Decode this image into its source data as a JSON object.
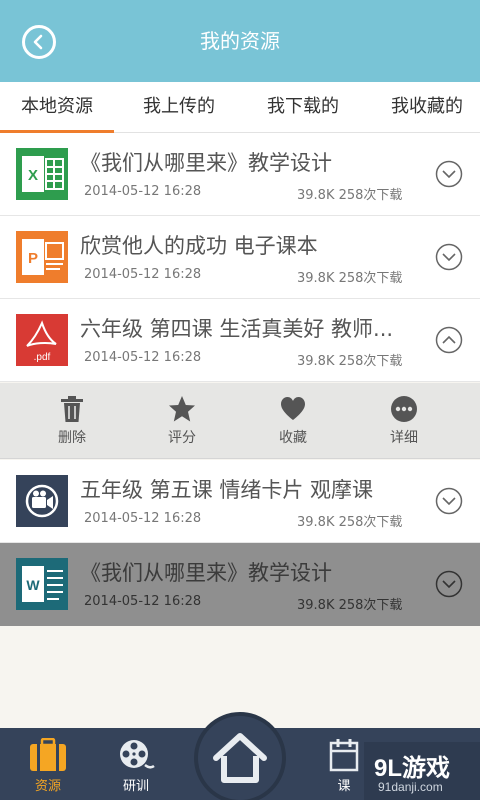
{
  "header": {
    "title": "我的资源"
  },
  "tabs": [
    {
      "label": "本地资源",
      "active": true
    },
    {
      "label": "我上传的",
      "active": false
    },
    {
      "label": "我下载的",
      "active": false
    },
    {
      "label": "我收藏的",
      "active": false
    }
  ],
  "files": [
    {
      "type": "excel",
      "title": "《我们从哪里来》教学设计",
      "date": "2014-05-12  16:28",
      "meta": "39.8K  258次下载",
      "expanded": false
    },
    {
      "type": "powerpoint",
      "title": "欣赏他人的成功 电子课本",
      "date": "2014-05-12  16:28",
      "meta": "39.8K  258次下载",
      "expanded": false
    },
    {
      "type": "pdf",
      "title": "六年级 第四课 生活真美好 教师...",
      "date": "2014-05-12  16:28",
      "meta": "39.8K  258次下载",
      "expanded": true
    },
    {
      "type": "video",
      "title": "五年级 第五课 情绪卡片 观摩课",
      "date": "2014-05-12  16:28",
      "meta": "39.8K  258次下载",
      "expanded": false
    },
    {
      "type": "word",
      "title": "《我们从哪里来》教学设计",
      "date": "2014-05-12  16:28",
      "meta": "39.8K  258次下载",
      "expanded": false
    }
  ],
  "actions": [
    {
      "label": "删除",
      "icon": "trash-icon"
    },
    {
      "label": "评分",
      "icon": "star-icon"
    },
    {
      "label": "收藏",
      "icon": "heart-icon"
    },
    {
      "label": "详细",
      "icon": "more-icon"
    }
  ],
  "bottom_nav": [
    {
      "label": "资源",
      "icon": "briefcase-icon",
      "active": true
    },
    {
      "label": "研训",
      "icon": "film-reel-icon",
      "active": false
    },
    {
      "label": "课",
      "icon": "calendar-icon",
      "active": false
    }
  ],
  "watermark": {
    "logo": "9L游戏",
    "url": "91danji.com"
  },
  "colors": {
    "header": "#79c4d6",
    "accent": "#ef7d2c",
    "nav": "#35435a",
    "nav_active": "#f5a623"
  }
}
